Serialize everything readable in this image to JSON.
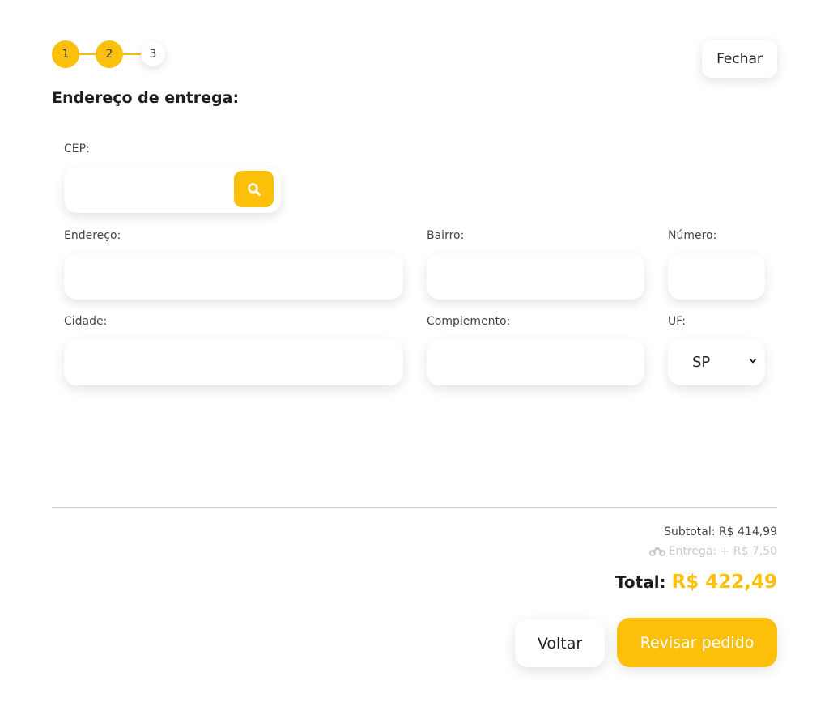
{
  "stepper": {
    "steps": [
      {
        "label": "1",
        "state": "active"
      },
      {
        "label": "2",
        "state": "active"
      },
      {
        "label": "3",
        "state": "inactive"
      }
    ]
  },
  "header": {
    "close_label": "Fechar"
  },
  "form": {
    "title": "Endereço de entrega:",
    "cep": {
      "label": "CEP:",
      "value": "",
      "search_icon": "search-icon"
    },
    "endereco": {
      "label": "Endereço:",
      "value": ""
    },
    "bairro": {
      "label": "Bairro:",
      "value": ""
    },
    "numero": {
      "label": "Número:",
      "value": ""
    },
    "cidade": {
      "label": "Cidade:",
      "value": ""
    },
    "complemento": {
      "label": "Complemento:",
      "value": ""
    },
    "uf": {
      "label": "UF:",
      "selected": "SP"
    }
  },
  "summary": {
    "subtotal": "Subtotal: R$ 414,99",
    "delivery": "Entrega: + R$ 7,50",
    "delivery_icon": "motorcycle-icon",
    "total_label": "Total:",
    "total_value": "R$ 422,49"
  },
  "actions": {
    "back_label": "Voltar",
    "review_label": "Revisar pedido"
  },
  "colors": {
    "accent": "#fcc00a",
    "muted": "#c9c9c9"
  }
}
